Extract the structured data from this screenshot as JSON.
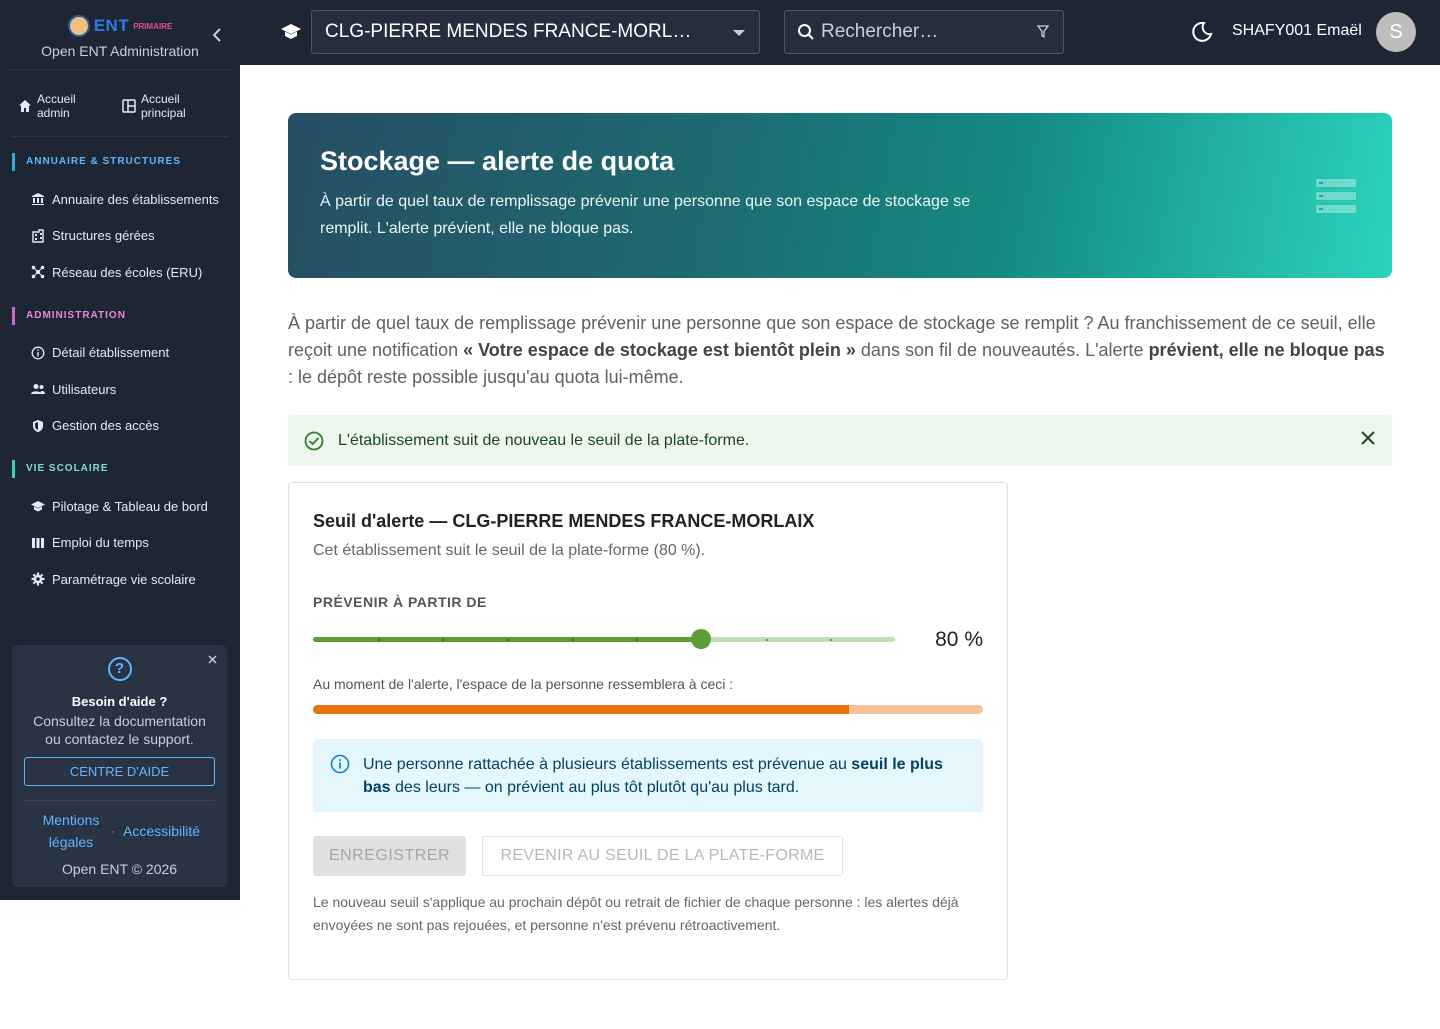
{
  "sidebar": {
    "brand": {
      "logo_main": "ENT",
      "logo_sub": "PRIMAIRE",
      "subtitle": "Open ENT Administration"
    },
    "quick_links": [
      {
        "label": "Accueil admin",
        "icon": "home-icon"
      },
      {
        "label": "Accueil principal",
        "icon": "dashboard-icon"
      }
    ],
    "sections": [
      {
        "title": "ANNUAIRE & STRUCTURES",
        "items": [
          {
            "label": "Annuaire des établissements",
            "icon": "bank-icon"
          },
          {
            "label": "Structures gérées",
            "icon": "building-icon"
          },
          {
            "label": "Réseau des écoles (ERU)",
            "icon": "network-icon"
          }
        ]
      },
      {
        "title": "ADMINISTRATION",
        "items": [
          {
            "label": "Détail établissement",
            "icon": "info-icon"
          },
          {
            "label": "Utilisateurs",
            "icon": "users-icon"
          },
          {
            "label": "Gestion des accès",
            "icon": "shield-icon"
          }
        ]
      },
      {
        "title": "VIE SCOLAIRE",
        "items": [
          {
            "label": "Pilotage & Tableau de bord",
            "icon": "school-icon"
          },
          {
            "label": "Emploi du temps",
            "icon": "timetable-icon"
          },
          {
            "label": "Paramétrage vie scolaire",
            "icon": "gear-icon"
          }
        ]
      }
    ],
    "help": {
      "title": "Besoin d'aide ?",
      "text": "Consultez la documentation ou contactez le support.",
      "button": "CENTRE D'AIDE",
      "link_legal": "Mentions légales",
      "separator": "·",
      "link_access": "Accessibilité",
      "copyright": "Open ENT © 2026"
    }
  },
  "topbar": {
    "school": "CLG-PIERRE MENDES FRANCE-MORL…",
    "search_placeholder": "Rechercher…",
    "username": "SHAFY001 Emaël",
    "avatar_initial": "S"
  },
  "hero": {
    "title": "Stockage — alerte de quota",
    "subtitle": "À partir de quel taux de remplissage prévenir une personne que son espace de stockage se remplit. L'alerte prévient, elle ne bloque pas."
  },
  "intro": {
    "part1": "À partir de quel taux de remplissage prévenir une personne que son espace de stockage se remplit ? Au franchissement de ce seuil, elle reçoit une notification ",
    "bold1": "« Votre espace de stockage est bientôt plein »",
    "part2": " dans son fil de nouveautés. L'alerte ",
    "bold2": "prévient, elle ne bloque pas",
    "part3": " : le dépôt reste possible jusqu'au quota lui-même."
  },
  "success_alert": "L'établissement suit de nouveau le seuil de la plate-forme.",
  "card": {
    "title": "Seuil d'alerte — CLG-PIERRE MENDES FRANCE-MORLAIX",
    "subtitle": "Cet établissement suit le seuil de la plate-forme (80 %).",
    "slider_label": "PRÉVENIR À PARTIR DE",
    "slider_value": 80,
    "slider_min": 50,
    "slider_max": 95,
    "slider_step": 5,
    "slider_display": "80 %",
    "preview_label": "Au moment de l'alerte, l'espace de la personne ressemblera à ceci :",
    "preview_fill": 80,
    "info_part1": "Une personne rattachée à plusieurs établissements est prévenue au ",
    "info_bold": "seuil le plus bas",
    "info_part2": " des leurs — on prévient au plus tôt plutôt qu'au plus tard.",
    "save_label": "ENREGISTRER",
    "revert_label": "REVENIR AU SEUIL DE LA PLATE-FORME",
    "footnote": "Le nouveau seuil s'applique au prochain dépôt ou retrait de fichier de chaque personne : les alertes déjà envoyées ne sont pas rejouées, et personne n'est prévenu rétroactivement."
  },
  "colors": {
    "sidebar_bg": "#1f2633",
    "accent_blue": "#5fb6ff",
    "slider_green": "#5c9e34",
    "bar_orange": "#e8710a",
    "success_bg": "#edf7ed",
    "info_bg": "#e5f6fd"
  }
}
